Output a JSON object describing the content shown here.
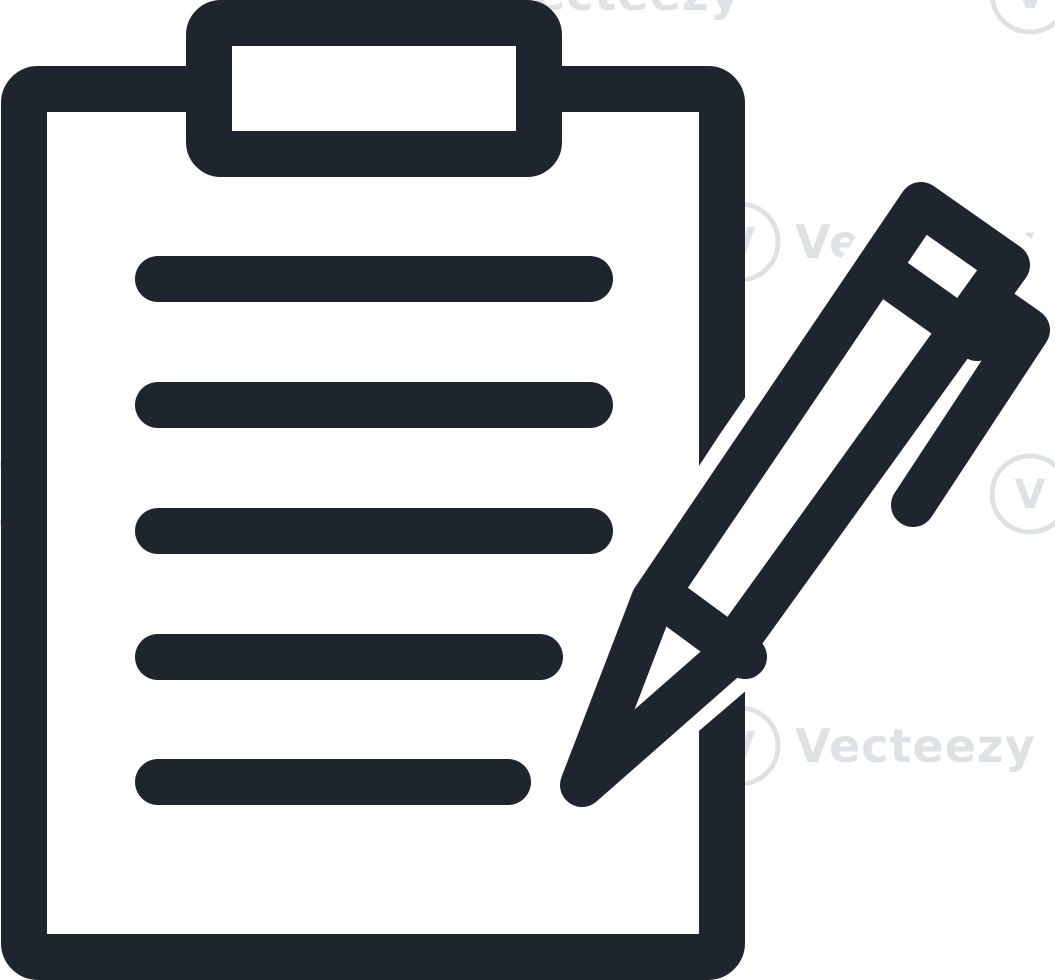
{
  "icon": {
    "name": "clipboard-with-pen-icon",
    "stroke_color": "#1e252e",
    "background_color": "#ffffff"
  },
  "watermark": {
    "text": "Vecteezy",
    "logo_glyph": "V",
    "color": "#dfe2e5"
  }
}
